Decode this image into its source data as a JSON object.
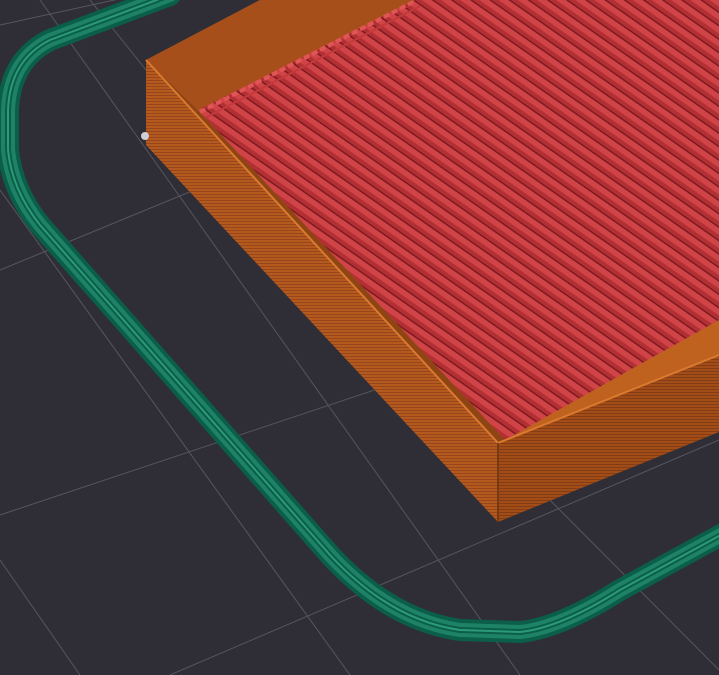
{
  "viewport": {
    "background": "#2f2e36",
    "grid_color": "#5a5a63"
  },
  "toolpath": {
    "skirt_color": "#0f6b52",
    "skirt_highlight": "#2a8f73",
    "perimeter_color": "#b65a20",
    "perimeter_shadow": "#8f4414",
    "infill_color": "#c83a3a",
    "infill_dark": "#8a1f24"
  },
  "icons": {
    "origin_marker": "origin-marker-icon"
  }
}
